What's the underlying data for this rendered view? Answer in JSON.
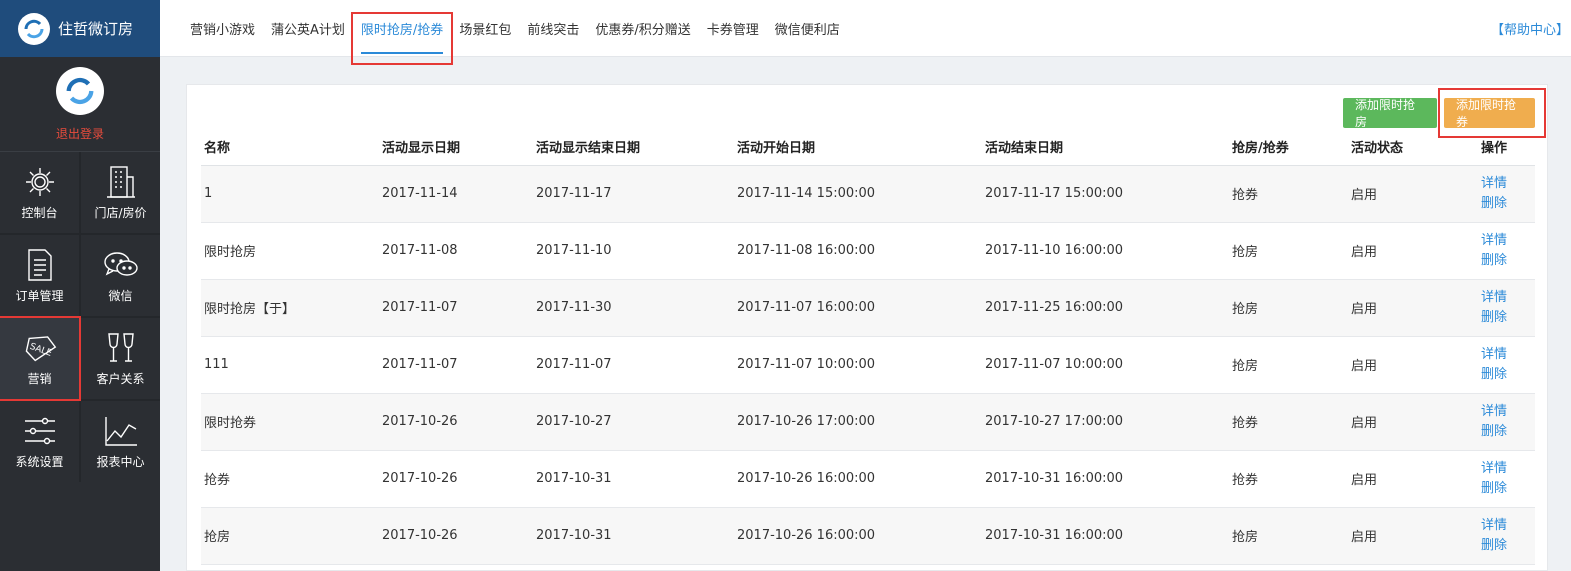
{
  "brand": {
    "title": "住哲微订房"
  },
  "profile": {
    "logout": "退出登录"
  },
  "nav": [
    {
      "label": "控制台",
      "icon": "sun-gear-icon"
    },
    {
      "label": "门店/房价",
      "icon": "building-icon"
    },
    {
      "label": "订单管理",
      "icon": "document-icon"
    },
    {
      "label": "微信",
      "icon": "wechat-icon"
    },
    {
      "label": "营销",
      "icon": "sale-tag-icon"
    },
    {
      "label": "客户关系",
      "icon": "wine-glasses-icon"
    },
    {
      "label": "系统设置",
      "icon": "sliders-icon"
    },
    {
      "label": "报表中心",
      "icon": "line-chart-icon"
    }
  ],
  "tabs": [
    "营销小游戏",
    "蒲公英A计划",
    "限时抢房/抢券",
    "场景红包",
    "前线突击",
    "优惠券/积分赠送",
    "卡券管理",
    "微信便利店"
  ],
  "help": "【帮助中心】",
  "buttons": {
    "add_room": "添加限时抢房",
    "add_coupon": "添加限时抢券"
  },
  "table": {
    "headers": [
      "名称",
      "活动显示日期",
      "活动显示结束日期",
      "活动开始日期",
      "活动结束日期",
      "抢房/抢券",
      "活动状态",
      "操作"
    ],
    "detail": "详情",
    "delete": "删除",
    "rows": [
      [
        "1",
        "2017-11-14",
        "2017-11-17",
        "2017-11-14 15:00:00",
        "2017-11-17 15:00:00",
        "抢券",
        "启用"
      ],
      [
        "限时抢房",
        "2017-11-08",
        "2017-11-10",
        "2017-11-08 16:00:00",
        "2017-11-10 16:00:00",
        "抢房",
        "启用"
      ],
      [
        "限时抢房【于】",
        "2017-11-07",
        "2017-11-30",
        "2017-11-07 16:00:00",
        "2017-11-25 16:00:00",
        "抢房",
        "启用"
      ],
      [
        "111",
        "2017-11-07",
        "2017-11-07",
        "2017-11-07 10:00:00",
        "2017-11-07 10:00:00",
        "抢房",
        "启用"
      ],
      [
        "限时抢券",
        "2017-10-26",
        "2017-10-27",
        "2017-10-26 17:00:00",
        "2017-10-27 17:00:00",
        "抢券",
        "启用"
      ],
      [
        "抢券",
        "2017-10-26",
        "2017-10-31",
        "2017-10-26 16:00:00",
        "2017-10-31 16:00:00",
        "抢券",
        "启用"
      ],
      [
        "抢房",
        "2017-10-26",
        "2017-10-31",
        "2017-10-26 16:00:00",
        "2017-10-31 16:00:00",
        "抢房",
        "启用"
      ]
    ]
  }
}
